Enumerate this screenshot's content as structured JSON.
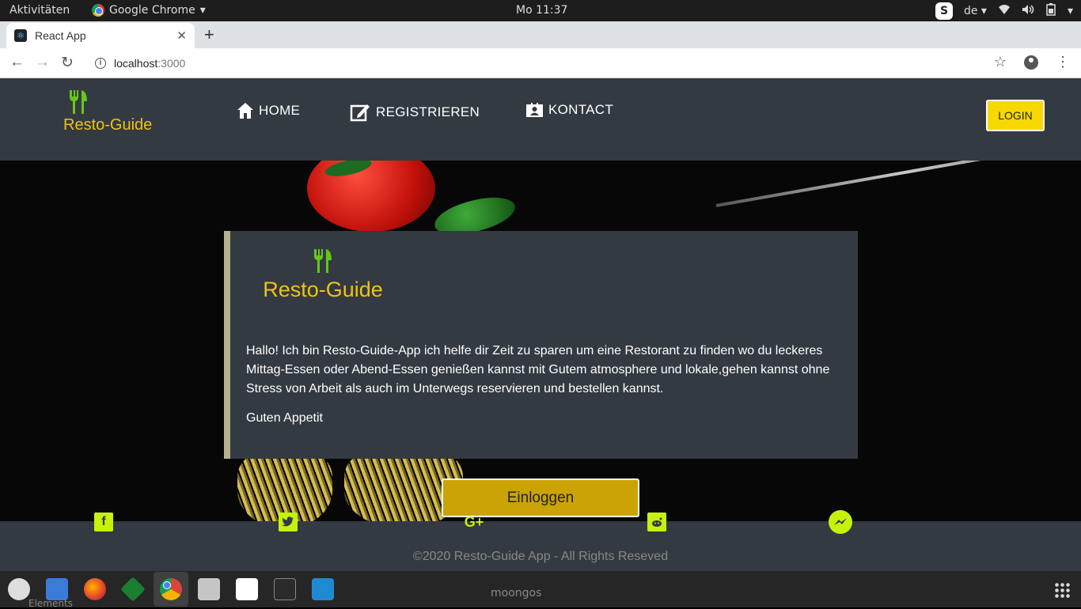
{
  "system": {
    "activities": "Aktivitäten",
    "app_name": "Google Chrome",
    "clock": "Mo 11:37",
    "lang": "de"
  },
  "browser": {
    "tab_title": "React App",
    "url_host": "localhost",
    "url_port": ":3000"
  },
  "header": {
    "brand": "Resto-Guide",
    "nav": [
      {
        "label": "HOME",
        "icon": "home-icon"
      },
      {
        "label": "REGISTRIEREN",
        "icon": "edit-icon"
      },
      {
        "label": "KONTACT",
        "icon": "contact-card-icon"
      }
    ],
    "login_label": "LOGIN"
  },
  "card": {
    "brand": "Resto-Guide",
    "text": "Hallo! Ich bin Resto-Guide-App ich helfe dir Zeit zu sparen um eine Restorant zu finden wo du leckeres Mittag-Essen oder Abend-Essen genießen kannst mit Gutem atmosphere und lokale,gehen kannst ohne Stress von Arbeit als auch im Unterwegs reservieren und bestellen kannst.",
    "greeting": "Guten Appetit"
  },
  "cta": {
    "label": "Einloggen"
  },
  "footer": {
    "social": [
      "facebook-icon",
      "twitter-icon",
      "google-plus-icon",
      "reddit-icon",
      "messenger-icon"
    ],
    "copyright": "©2020 Resto-Guide App - All Rights Reseved"
  },
  "dock": {
    "label_under": "Elements",
    "label_moongos": "moongos"
  },
  "colors": {
    "brand_yellow": "#f0c30f",
    "fork_green": "#67c718",
    "header_bg": "#343a42",
    "social_green": "#c5f20a"
  }
}
